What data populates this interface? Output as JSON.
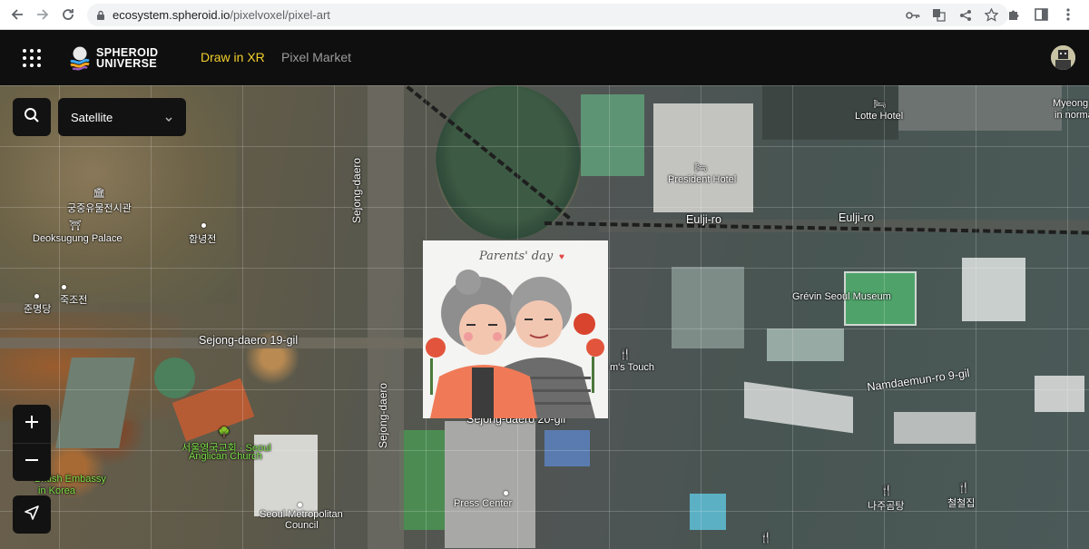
{
  "browser": {
    "url_host": "ecosystem.spheroid.io",
    "url_path": "/pixelvoxel/pixel-art"
  },
  "header": {
    "logo_line1": "SPHEROID",
    "logo_line2": "UNIVERSE",
    "nav": [
      {
        "label": "Draw in XR",
        "active": true
      },
      {
        "label": "Pixel Market",
        "active": false
      }
    ],
    "accent_color": "#f2cf2b"
  },
  "map_controls": {
    "layer_value": "Satellite",
    "zoom_in": "+",
    "zoom_out": "−"
  },
  "map_labels": {
    "lotte_hotel": "Lotte Hotel",
    "myeong": "Myeong",
    "in_norma": "in norma",
    "president_hotel": "President Hotel",
    "eulji_ro_1": "Eulji-ro",
    "eulji_ro_2": "Eulji-ro",
    "sejong_daero_v1": "Sejong-daero",
    "sejong_daero_v2": "Sejong-daero",
    "museum_kr": "궁중유물전시관",
    "deoksugung": "Deoksugung Palace",
    "hamnyeonjeon": "함녕전",
    "junmyeongdang": "준명당",
    "jukjojeon": "죽조전",
    "sejong_19gil": "Sejong-daero 19-gil",
    "sejong_20gil": "Sejong-daero 20-gil",
    "grevin": "Grévin Seoul Museum",
    "moms_touch": "m's Touch",
    "namdaemun": "Namdaemun-ro 9-gil",
    "church_kr": "서울영국교회 · Seoul",
    "church_en": "Anglican Church",
    "embassy": "British Embassy",
    "in_korea": "in Korea",
    "press_center": "Press Center",
    "seoul_metro_1": "Seoul Metropolitan",
    "seoul_metro_2": "Council",
    "najugomtang": "나주곰탕",
    "cheoljeop": "철철집"
  },
  "pixel_art": {
    "title": "Parents' day"
  }
}
